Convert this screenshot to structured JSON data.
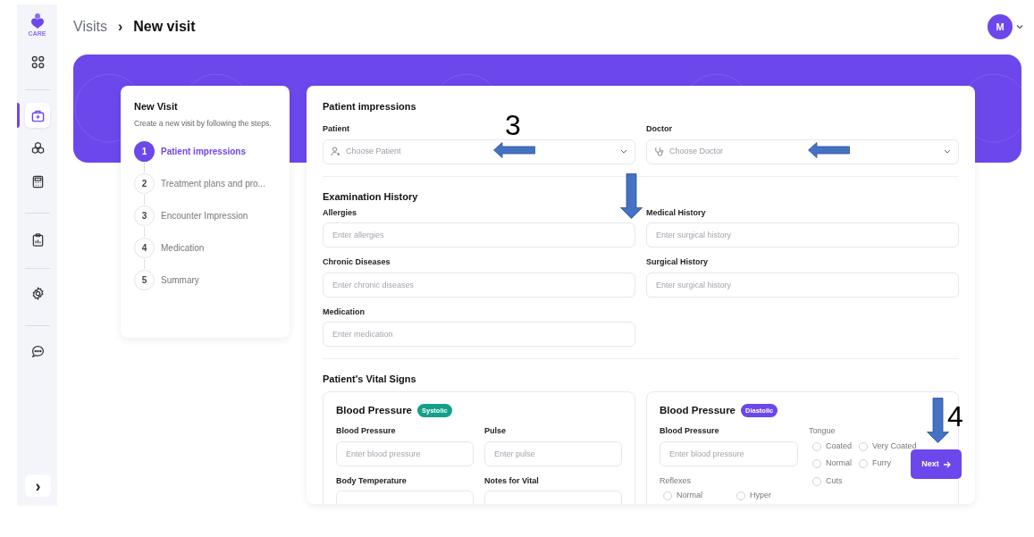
{
  "sidebar": {
    "logo_text": "CARE",
    "items": [
      {
        "selected": false
      },
      {
        "selected": true
      },
      {
        "selected": false
      },
      {
        "selected": false
      },
      {
        "selected": false
      },
      {
        "selected": false
      },
      {
        "selected": false
      }
    ],
    "expand_glyph": "›"
  },
  "breadcrumb": {
    "parent": "Visits",
    "separator": "›",
    "current": "New visit"
  },
  "user": {
    "initial": "M"
  },
  "steps_card": {
    "title": "New Visit",
    "subtitle": "Create a new visit by following the steps.",
    "steps": [
      {
        "number": "1",
        "label": "Patient impressions",
        "selected": true
      },
      {
        "number": "2",
        "label": "Treatment plans and pro...",
        "selected": false
      },
      {
        "number": "3",
        "label": "Encounter Impression",
        "selected": false
      },
      {
        "number": "4",
        "label": "Medication",
        "selected": false
      },
      {
        "number": "5",
        "label": "Summary",
        "selected": false
      }
    ]
  },
  "patient_impressions": {
    "title": "Patient impressions",
    "selects": [
      {
        "label": "Patient",
        "placeholder": "Choose Patient"
      },
      {
        "label": "Doctor",
        "placeholder": "Choose Doctor"
      }
    ]
  },
  "examination_history": {
    "title": "Examination History",
    "fields": [
      {
        "label": "Allergies",
        "placeholder": "Enter allergies"
      },
      {
        "label": "Medical History",
        "placeholder": "Enter surgical history"
      },
      {
        "label": "Chronic Diseases",
        "placeholder": "Enter chronic diseases"
      },
      {
        "label": "Surgical History",
        "placeholder": "Enter surgical history"
      },
      {
        "label": "Medication",
        "placeholder": "Enter medication"
      }
    ]
  },
  "vital_signs": {
    "title": "Patient's Vital Signs",
    "cards": [
      {
        "title": "Blood Pressure",
        "badge": "Systolic",
        "color": "#12a08a",
        "fields": [
          {
            "label": "Blood Pressure",
            "placeholder": "Enter blood pressure"
          },
          {
            "label": "Pulse",
            "placeholder": "Enter pulse"
          },
          {
            "label": "Body Temperature"
          },
          {
            "label": "Notes for Vital"
          }
        ]
      },
      {
        "title": "Blood Pressure",
        "badge": "Diastolic",
        "color": "#6c47ec",
        "fields": [
          {
            "label": "Blood Pressure",
            "placeholder": "Enter blood pressure"
          }
        ],
        "tongue": {
          "label": "Tongue",
          "options": [
            {
              "label": "Coated",
              "selected": false
            },
            {
              "label": "Very Coated",
              "selected": false
            },
            {
              "label": "Normal",
              "selected": false
            },
            {
              "label": "Furry",
              "selected": false
            },
            {
              "label": "Cuts",
              "selected": false
            }
          ]
        },
        "reflexes": {
          "label": "Reflexes",
          "options": [
            {
              "label": "Normal",
              "selected": false
            },
            {
              "label": "Hyper",
              "selected": false
            }
          ]
        }
      }
    ]
  },
  "next_button": {
    "label": "Next"
  },
  "annotations": {
    "labels": [
      "3",
      "4"
    ]
  }
}
